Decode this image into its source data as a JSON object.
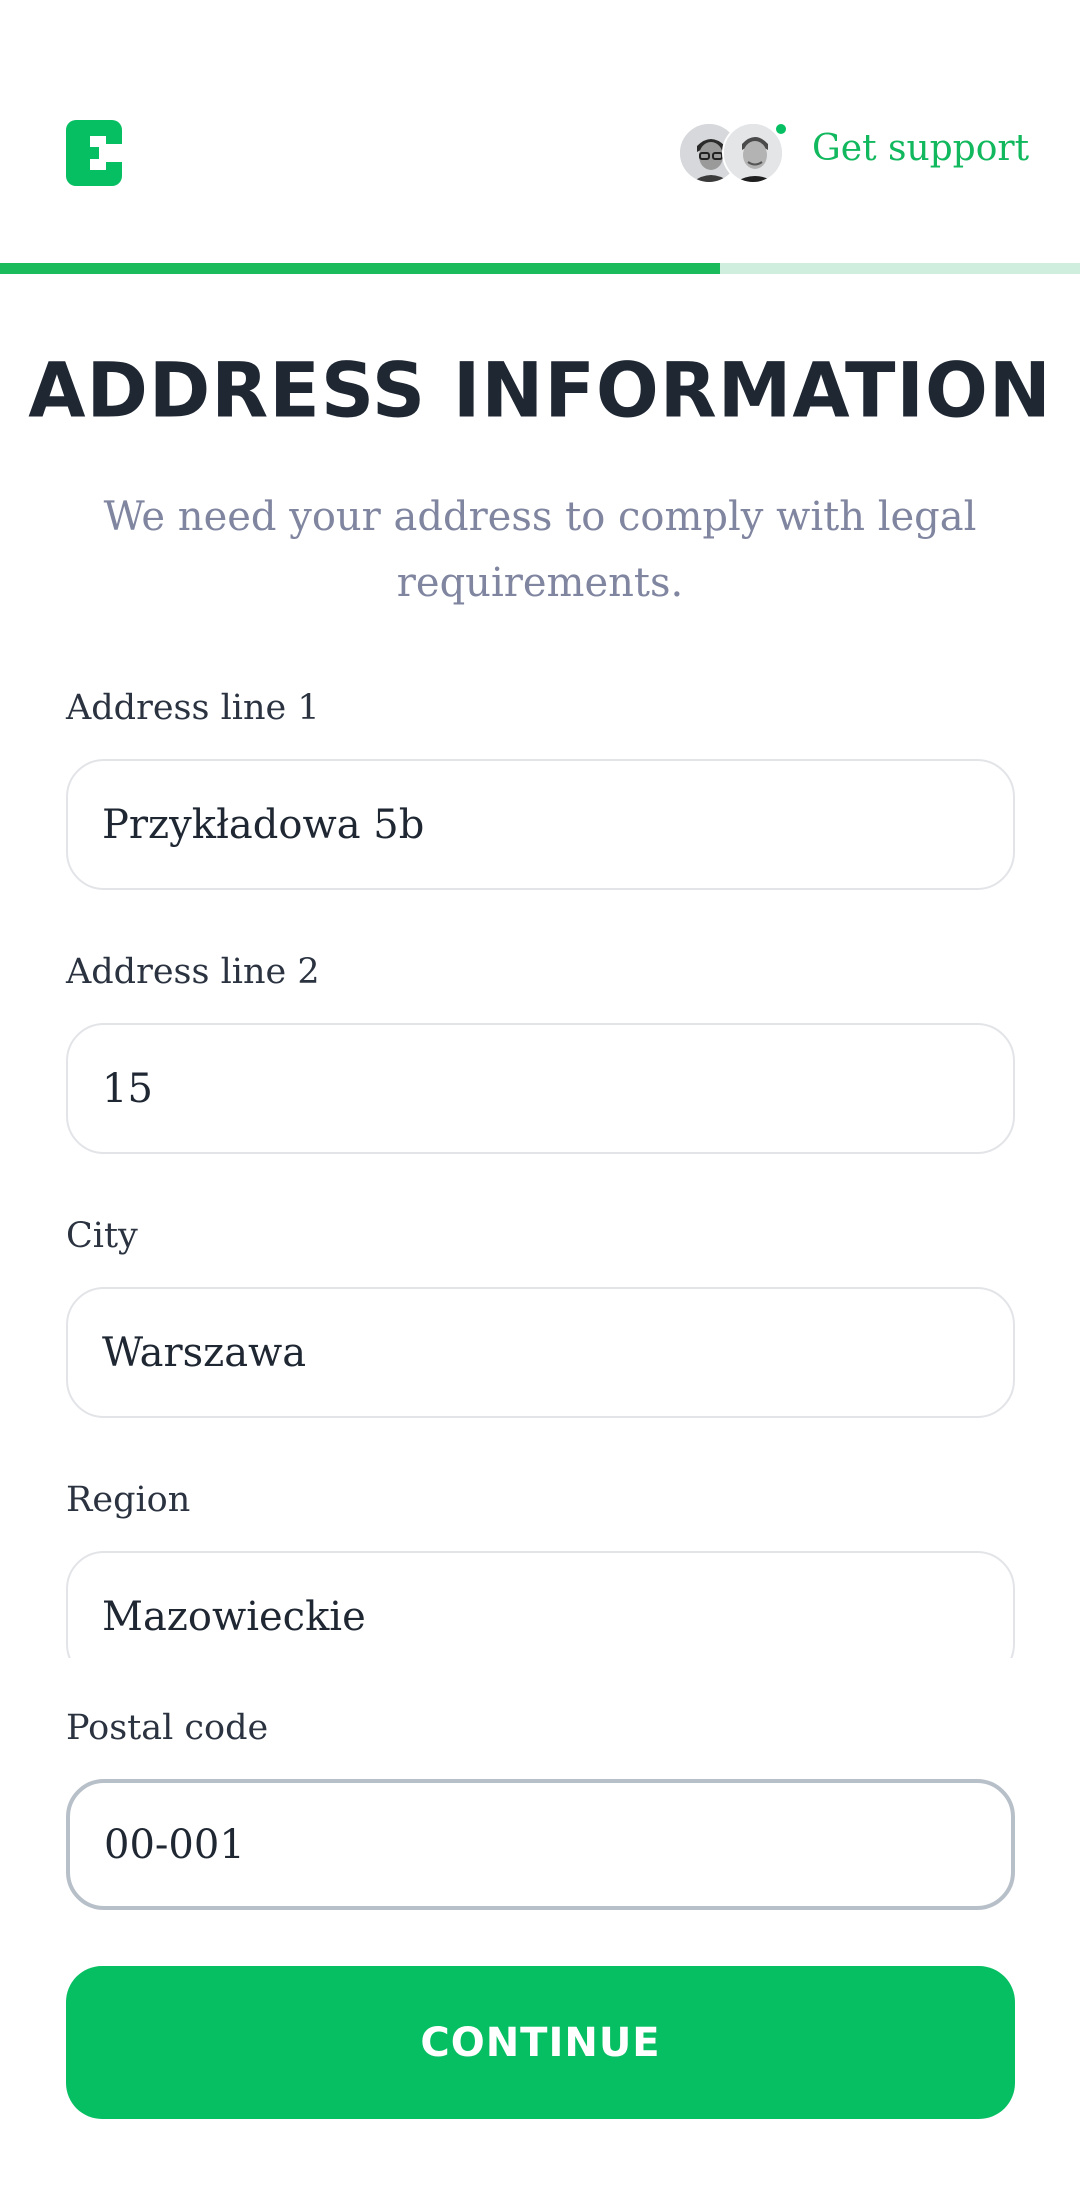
{
  "header": {
    "logo_icon": "brand-c-logo-icon",
    "support_label": "Get support",
    "avatars": [
      "support-agent-1",
      "support-agent-2"
    ],
    "online_status_color": "#07bf63"
  },
  "progress": {
    "completed_fraction": 0.667,
    "fill_color": "#1bbb5c",
    "track_color": "#cfeedd"
  },
  "page": {
    "title": "ADDRESS INFORMATION",
    "subtitle": "We need your address to comply with legal requirements."
  },
  "form": {
    "address_line_1": {
      "label": "Address line 1",
      "value": "Przykładowa 5b"
    },
    "address_line_2": {
      "label": "Address line 2",
      "value": "15"
    },
    "city": {
      "label": "City",
      "value": "Warszawa"
    },
    "region": {
      "label": "Region",
      "value": "Mazowieckie"
    },
    "postal_code": {
      "label": "Postal code",
      "value": "00-001"
    }
  },
  "actions": {
    "continue_label": "CONTINUE",
    "accent_color": "#07bf63"
  }
}
